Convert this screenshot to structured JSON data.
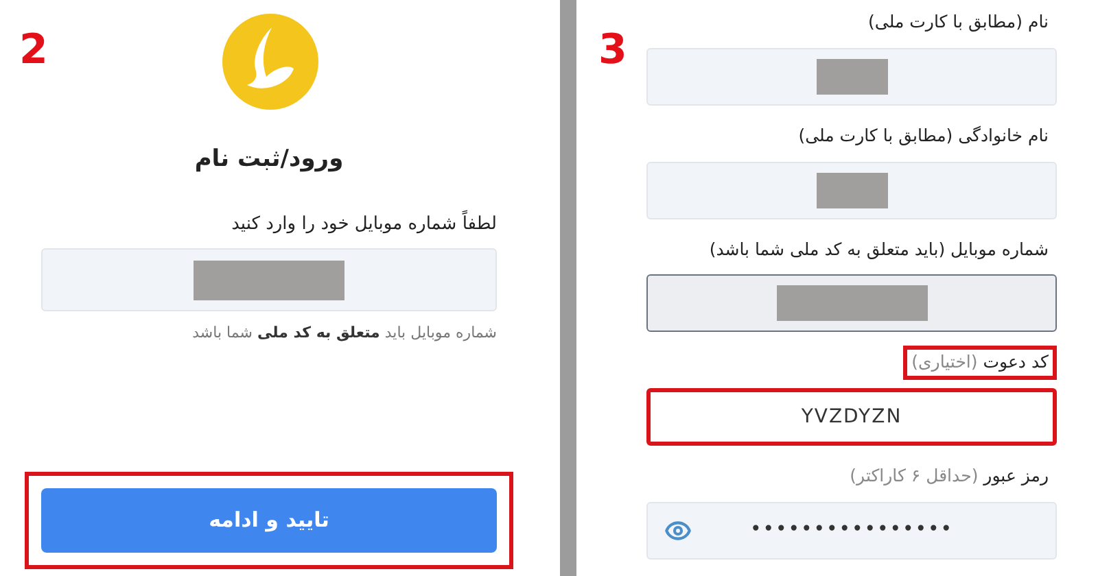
{
  "step_2": {
    "step_number": "2",
    "title": "ورود/ثبت نام",
    "phone_label": "لطفاً شماره موبایل خود را وارد کنید",
    "phone_field": {
      "redacted": true
    },
    "hint": "شماره موبایل باید **متعلق به کد ملی** شما باشد",
    "submit_button": {
      "label": "تایید و ادامه",
      "highlighted": true
    }
  },
  "step_3": {
    "step_number": "3",
    "fields": [
      {
        "kind": "text",
        "label": "نام (مطابق با کارت ملی)",
        "redacted": true,
        "disabled": false,
        "highlighted": false
      },
      {
        "kind": "text",
        "label": "نام خانوادگی (مطابق با کارت ملی)",
        "redacted": true,
        "disabled": false,
        "highlighted": false
      },
      {
        "kind": "text",
        "label": "شماره موبایل (باید متعلق به کد ملی شما باشد)",
        "redacted": true,
        "disabled": true,
        "highlighted": false
      },
      {
        "kind": "text",
        "label": "کد دعوت",
        "note": "(اختیاری)",
        "value": "YVZDYZN",
        "redacted": false,
        "disabled": false,
        "highlighted": true
      },
      {
        "kind": "password",
        "label": "رمز عبور",
        "note": "(حداقل ۶ کاراکتر)",
        "value": "••••••••••••••••",
        "redacted": false,
        "disabled": false,
        "highlighted": false
      }
    ]
  }
}
